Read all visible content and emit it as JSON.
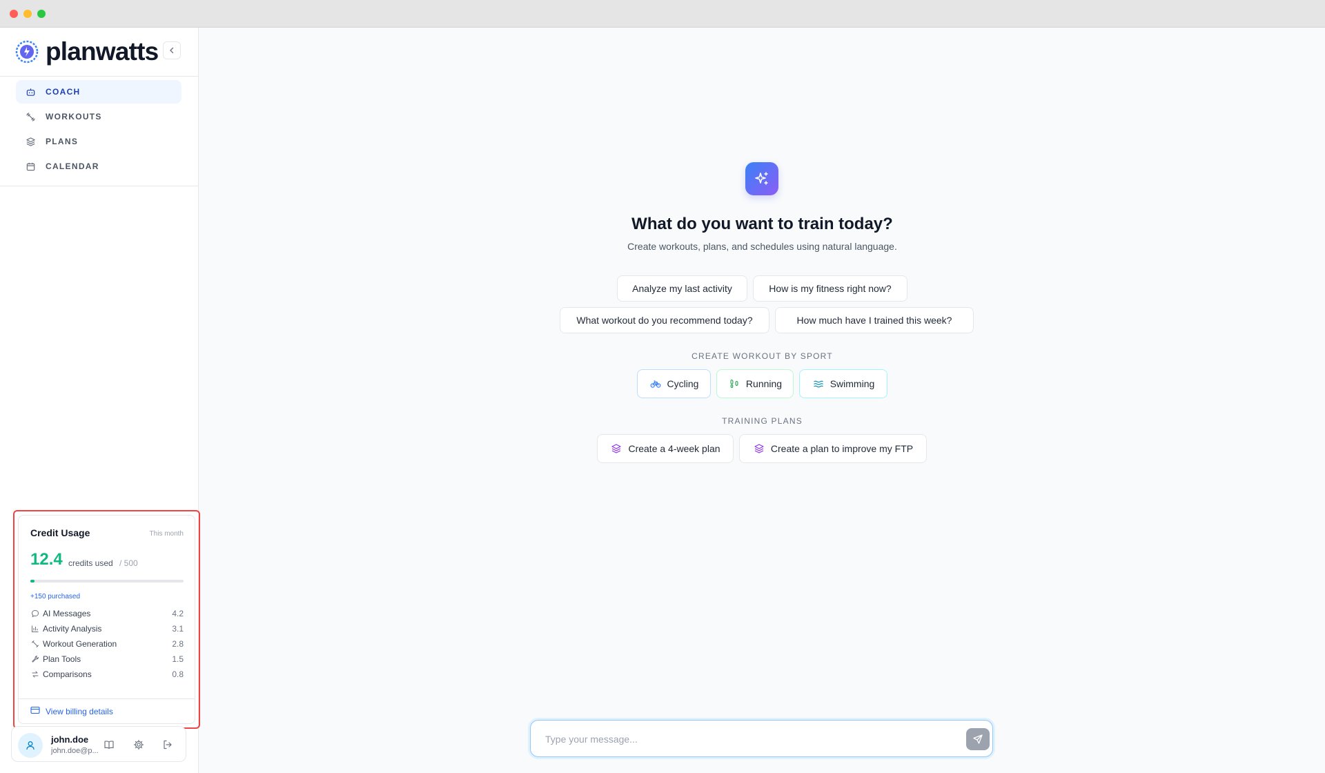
{
  "window": {
    "controls": [
      "close",
      "minimize",
      "zoom"
    ]
  },
  "brand": {
    "name": "planwatts",
    "logo_icon": "planwatts-logo",
    "collapse_icon": "chevron-left-icon"
  },
  "nav": {
    "items": [
      {
        "label": "COACH",
        "icon": "bot-icon",
        "active": true
      },
      {
        "label": "WORKOUTS",
        "icon": "dumbbell-icon",
        "active": false
      },
      {
        "label": "PLANS",
        "icon": "layers-icon",
        "active": false
      },
      {
        "label": "CALENDAR",
        "icon": "calendar-icon",
        "active": false
      }
    ]
  },
  "credits": {
    "title": "Credit Usage",
    "period": "This month",
    "used_value": "12.4",
    "used_label": "credits used",
    "total": "/ 500",
    "progress_fraction": 0.025,
    "purchased": "+150 purchased",
    "breakdown": [
      {
        "name": "AI Messages",
        "value": "4.2",
        "icon": "message-icon"
      },
      {
        "name": "Activity Analysis",
        "value": "3.1",
        "icon": "bar-chart-icon"
      },
      {
        "name": "Workout Generation",
        "value": "2.8",
        "icon": "dumbbell-icon"
      },
      {
        "name": "Plan Tools",
        "value": "1.5",
        "icon": "wrench-icon"
      },
      {
        "name": "Comparisons",
        "value": "0.8",
        "icon": "compare-icon"
      }
    ],
    "billing_link": "View billing details"
  },
  "user": {
    "name": "john.doe",
    "email": "john.doe@p...",
    "actions": [
      "book-icon",
      "gear-icon",
      "logout-icon"
    ]
  },
  "hero": {
    "icon": "sparkles-icon",
    "title": "What do you want to train today?",
    "subtitle": "Create workouts, plans, and schedules using natural language."
  },
  "suggestions": [
    "Analyze my last activity",
    "How is my fitness right now?",
    "What workout do you recommend today?",
    "How much have I trained this week?"
  ],
  "sport_section": {
    "label": "CREATE WORKOUT BY SPORT",
    "sports": [
      {
        "label": "Cycling",
        "icon": "bike-icon"
      },
      {
        "label": "Running",
        "icon": "footprints-icon"
      },
      {
        "label": "Swimming",
        "icon": "waves-icon"
      }
    ]
  },
  "plans_section": {
    "label": "TRAINING PLANS",
    "plans": [
      {
        "label": "Create a 4-week plan",
        "icon": "layers-icon"
      },
      {
        "label": "Create a plan to improve my FTP",
        "icon": "layers-icon"
      }
    ]
  },
  "composer": {
    "placeholder": "Type your message...",
    "send_icon": "send-icon"
  },
  "colors": {
    "accent": "#2563eb",
    "credit_green": "#10b981",
    "highlight_border": "#ef4444"
  }
}
